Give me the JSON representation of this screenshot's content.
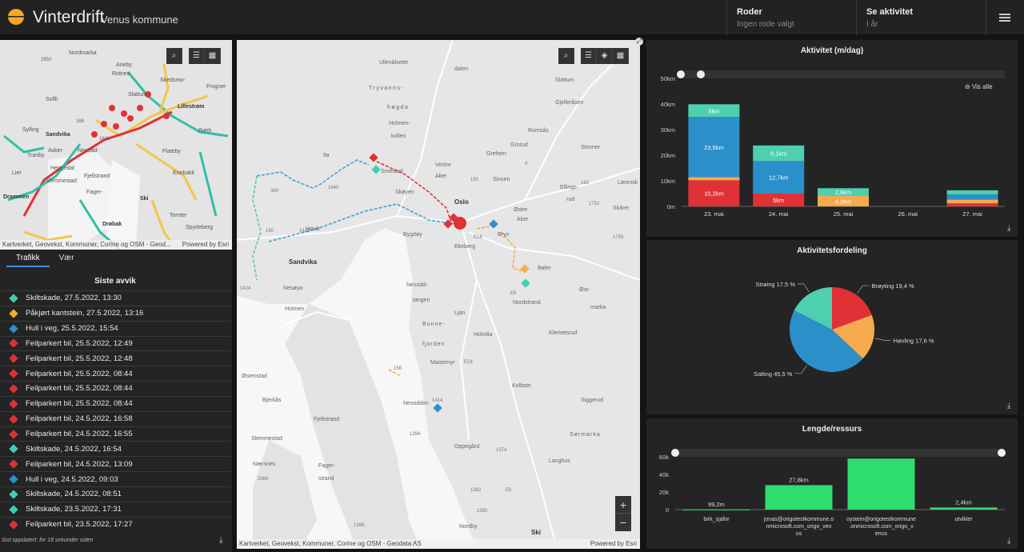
{
  "header": {
    "title": "Vinterdrift",
    "subtitle": "Venus kommune",
    "routes_label": "Roder",
    "routes_value": "Ingen rode valgt",
    "activity_label": "Se aktivitet",
    "activity_value": "I år"
  },
  "overview_map": {
    "attribution": "Kartverket, Geovekst, Kommuner, Corine og OSM - Geod...",
    "powered": "Powered by Esri",
    "places": [
      "Nordmarka",
      "Aneby",
      "Rotnes",
      "Skedsmo-\nkorset",
      "Frogner",
      "Lillestrøm",
      "Sollli",
      "Slattum",
      "Sylling",
      "Sandvika",
      "Asker",
      "Tranby",
      "Nesodd-",
      "Heggedal",
      "Fjellstrand",
      "Slemmestad",
      "Lier",
      "Drammen",
      "Flateby",
      "Bjørk",
      "Enebakk",
      "Fager-",
      "Ski",
      "Drøbak",
      "Tomter",
      "Spydeberg"
    ],
    "road_numbers": [
      "2850",
      "168",
      "1648",
      "168",
      "160"
    ]
  },
  "tabs": [
    "Trafikk",
    "Vær"
  ],
  "events_title": "Siste avvik",
  "events": [
    {
      "text": "Skiltskade, 27.5.2022, 13:30",
      "color": "#3ecfb3"
    },
    {
      "text": "Påkjørt kantstein, 27.5.2022, 13:16",
      "color": "#f2a93b"
    },
    {
      "text": "Hull i veg, 25.5.2022, 15:54",
      "color": "#2b8fc9"
    },
    {
      "text": "Feilparkert bil, 25.5.2022, 12:49",
      "color": "#e03236"
    },
    {
      "text": "Feilparkert bil, 25.5.2022, 12:48",
      "color": "#e03236"
    },
    {
      "text": "Feilparkert bil, 25.5.2022, 08:44",
      "color": "#e03236"
    },
    {
      "text": "Feilparkert bil, 25.5.2022, 08:44",
      "color": "#e03236"
    },
    {
      "text": "Feilparkert bil, 25.5.2022, 08:44",
      "color": "#e03236"
    },
    {
      "text": "Feilparkert bil, 24.5.2022, 16:58",
      "color": "#e03236"
    },
    {
      "text": "Feilparkert bil, 24.5.2022, 16:55",
      "color": "#e03236"
    },
    {
      "text": "Skiltskade, 24.5.2022, 16:54",
      "color": "#3ecfb3"
    },
    {
      "text": "Feilparkert bil, 24.5.2022, 13:09",
      "color": "#e03236"
    },
    {
      "text": "Hull i veg, 24.5.2022, 09:03",
      "color": "#2b8fc9"
    },
    {
      "text": "Skiltskade, 24.5.2022, 08:51",
      "color": "#3ecfb3"
    },
    {
      "text": "Skiltskade, 23.5.2022, 17:31",
      "color": "#3ecfb3"
    },
    {
      "text": "Feilparkert bil, 23.5.2022, 17:27",
      "color": "#e03236"
    }
  ],
  "events_footer": "Sist oppdatert: for 18 sekunder siden",
  "main_map": {
    "attribution": "Kartverket, Geovekst, Kommuner, Corine og OSM - Geodata AS",
    "powered": "Powered by Esri",
    "zoom_in": "+",
    "zoom_out": "−",
    "places": [
      "Ullevålseter",
      "Tryvanns-",
      "høgda",
      "Holmen-",
      "kollen",
      "Vestre",
      "Aker",
      "Grefsen",
      "Grorud",
      "Stovner",
      "Romsås",
      "Gjelleråsen",
      "Slattum",
      "Sinsen",
      "Ellings-",
      "rud",
      "Lørensk",
      "Skøyen",
      "Oslo",
      "Østre",
      "Aker",
      "Bygdøy",
      "Ekeberg",
      "Bryn",
      "Høvik",
      "Sandvika",
      "Bøler",
      "Nesøya",
      "Nesodd-",
      "tangen",
      "Ljan",
      "Nordstrand",
      "Øst-",
      "marka",
      "Holmen",
      "Bunne-",
      "fjorden",
      "Holmlia",
      "Klemetsrud",
      "Østenstad",
      "Mastemyr",
      "Kolbotn",
      "Bjerkås",
      "Nesodden",
      "Siggerud",
      "Fjellstrand",
      "Slemmestad",
      "Sørmarka",
      "Oppegård",
      "Langhus",
      "Nærsnes",
      "Fager-",
      "strand",
      "Nordby",
      "Ski",
      "Skårer",
      "Smestad",
      "Ila",
      "dalen"
    ],
    "road_numbers": [
      "163",
      "150",
      "4",
      "150",
      "1640",
      "380",
      "160",
      "1428",
      "E18",
      "1752",
      "1755",
      "1424",
      "E6",
      "156",
      "1414",
      "1394",
      "1394",
      "1374",
      "1398",
      "E18",
      "2686",
      "E6",
      "1380",
      "1382"
    ]
  },
  "activity_chart": {
    "title": "Aktivitet (m/dag)",
    "show_all": "Vis alle",
    "chart_data": {
      "type": "bar",
      "categories": [
        "23. mai",
        "24. mai",
        "25. mai",
        "26. mai",
        "27. mai"
      ],
      "yticks": [
        "0m",
        "10km",
        "20km",
        "30km",
        "40km",
        "50km"
      ],
      "ylim": [
        0,
        50
      ],
      "series": [
        {
          "color": "#e03236",
          "values": [
            10.2,
            5,
            0,
            0,
            1.2
          ],
          "labels": [
            "10,2km",
            "5km",
            "",
            "",
            ""
          ]
        },
        {
          "color": "#f5ab4e",
          "values": [
            1.2,
            0,
            4.2,
            0,
            1.5
          ],
          "labels": [
            "",
            "",
            "4,2km",
            "",
            ""
          ]
        },
        {
          "color": "#2b8fc9",
          "values": [
            23.5,
            12.7,
            0,
            0,
            2.0
          ],
          "labels": [
            "23,5km",
            "12,7km",
            "",
            "",
            ""
          ]
        },
        {
          "color": "#4ecfb0",
          "values": [
            5,
            6.1,
            2.9,
            0,
            1.6
          ],
          "labels": [
            "5km",
            "6,1km",
            "2,9km",
            "",
            ""
          ]
        }
      ]
    }
  },
  "distribution_chart": {
    "title": "Aktivitetsfordeling",
    "chart_data": {
      "type": "pie",
      "slices": [
        {
          "label": "Brøyting 19,4 %",
          "value": 19.4,
          "color": "#e03236"
        },
        {
          "label": "Høvling 17,6 %",
          "value": 17.6,
          "color": "#f5ab4e"
        },
        {
          "label": "Salting 45,5 %",
          "value": 45.5,
          "color": "#2b8fc9"
        },
        {
          "label": "Strøing 17,5 %",
          "value": 17.5,
          "color": "#4ecfb0"
        }
      ]
    }
  },
  "resource_chart": {
    "title": "Lengde/ressurs",
    "chart_data": {
      "type": "bar",
      "categories": [
        "birk_sjafor",
        "jonas@origotestkommune.o nmicrosoft.com_origo_ven us",
        "oystein@origotestkommune .onmicrosoft.com_origo_v enus",
        "utvikler"
      ],
      "values": [
        0.0992,
        27.8,
        58,
        2.4
      ],
      "labels": [
        "99,2m",
        "27,8km",
        "",
        "2,4km"
      ],
      "yticks": [
        "0",
        "20k",
        "40k",
        "60k"
      ],
      "ylim": [
        0,
        60
      ],
      "color": "#2fdc6e"
    }
  }
}
